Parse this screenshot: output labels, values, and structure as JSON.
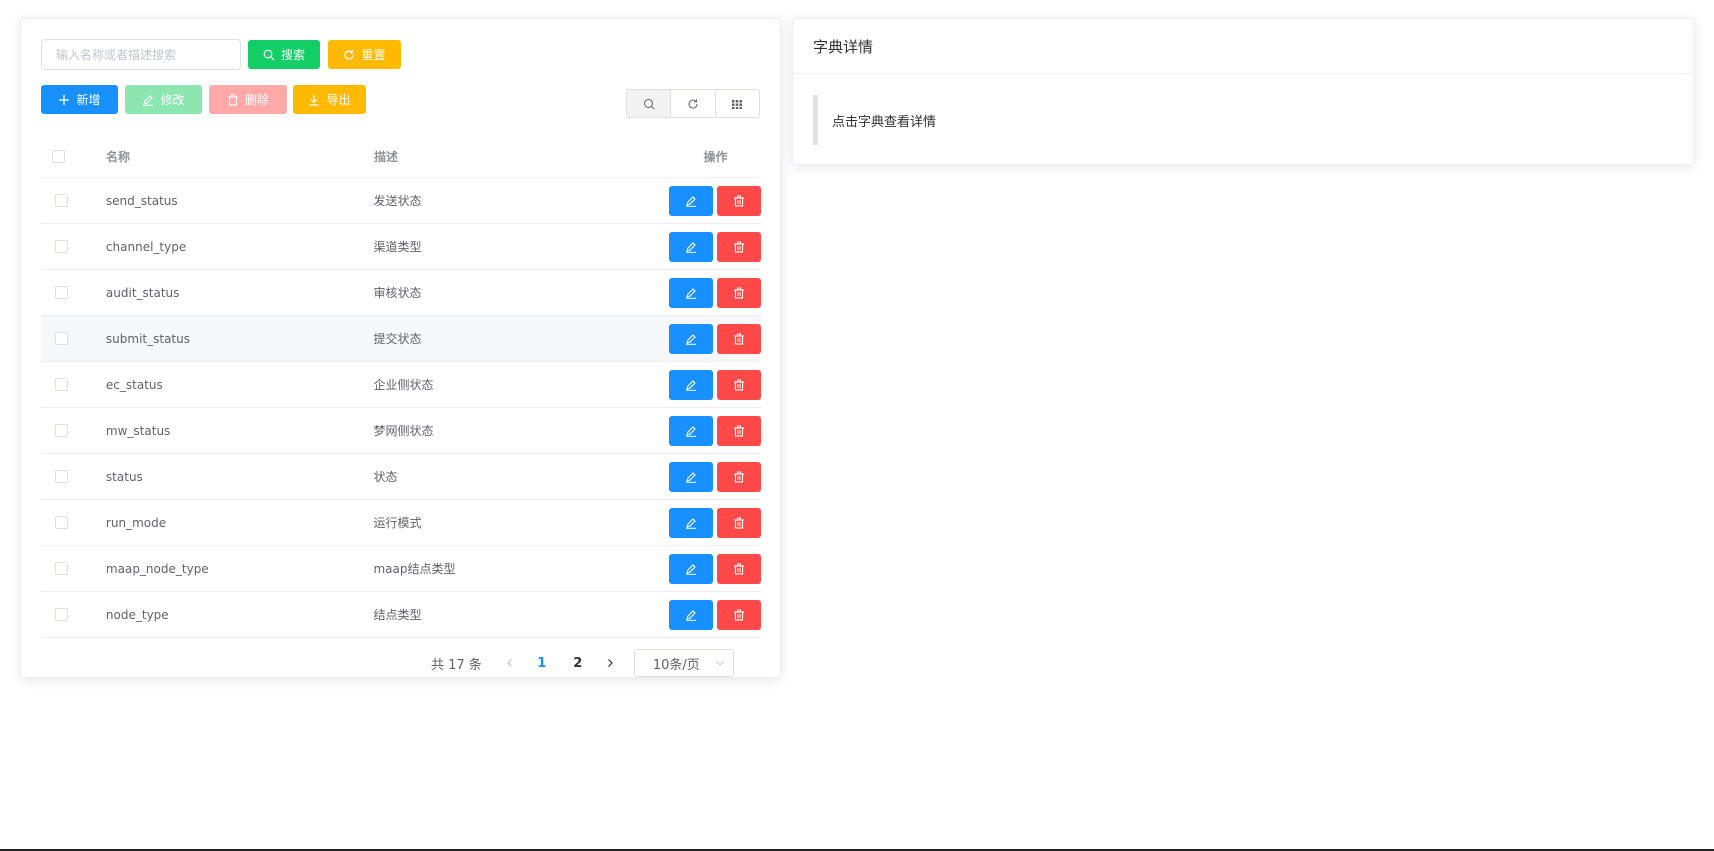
{
  "search": {
    "placeholder": "输入名称或者描述搜索",
    "value": ""
  },
  "toolbar": {
    "search_label": "搜索",
    "reset_label": "重置",
    "add_label": "新增",
    "edit_label": "修改",
    "delete_label": "删除",
    "export_label": "导出"
  },
  "table": {
    "headers": {
      "name": "名称",
      "desc": "描述",
      "ops": "操作"
    },
    "rows": [
      {
        "name": "send_status",
        "desc": "发送状态"
      },
      {
        "name": "channel_type",
        "desc": "渠道类型"
      },
      {
        "name": "audit_status",
        "desc": "审核状态"
      },
      {
        "name": "submit_status",
        "desc": "提交状态"
      },
      {
        "name": "ec_status",
        "desc": "企业侧状态"
      },
      {
        "name": "mw_status",
        "desc": "梦网侧状态"
      },
      {
        "name": "status",
        "desc": "状态"
      },
      {
        "name": "run_mode",
        "desc": "运行模式"
      },
      {
        "name": "maap_node_type",
        "desc": "maap结点类型"
      },
      {
        "name": "node_type",
        "desc": "结点类型"
      }
    ]
  },
  "pagination": {
    "total_label": "共 17 条",
    "pages": [
      "1",
      "2"
    ],
    "current_page": "1",
    "page_size_label": "10条/页"
  },
  "detail": {
    "title": "字典详情",
    "hint": "点击字典查看详情"
  },
  "colors": {
    "primary": "#1890ff",
    "success": "#13ce66",
    "warning": "#ffba00",
    "danger": "#ff4949"
  }
}
